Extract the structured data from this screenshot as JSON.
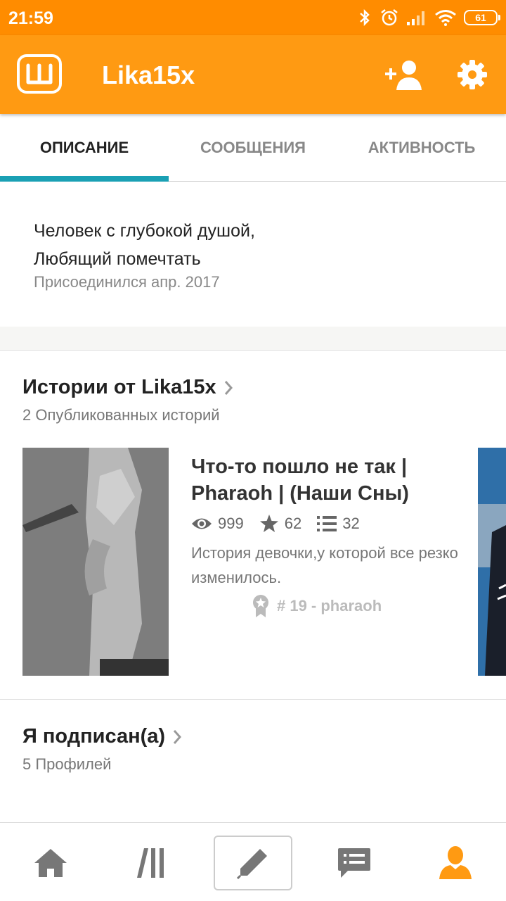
{
  "status_bar": {
    "time": "21:59",
    "battery": "61",
    "icons": [
      "bluetooth-icon",
      "alarm-icon",
      "signal-icon",
      "wifi-icon",
      "battery-icon"
    ]
  },
  "app_bar": {
    "title": "Lika15x",
    "logo_icon": "wattpad-logo",
    "actions": [
      "add-user-icon",
      "gear-icon"
    ]
  },
  "tabs": [
    {
      "label": "ОПИСАНИЕ",
      "active": true
    },
    {
      "label": "СООБЩЕНИЯ",
      "active": false
    },
    {
      "label": "АКТИВНОСТЬ",
      "active": false
    }
  ],
  "about": {
    "bio_line1": "Человек с глубокой душой,",
    "bio_line2": "Любящий помечтать",
    "joined": "Присоединился апр. 2017"
  },
  "stories": {
    "title": "Истории от Lika15x",
    "subtitle": "2 Опубликованных историй",
    "items": [
      {
        "title": "Что-то пошло не так | Pharaoh | (Наши Сны)",
        "reads": "999",
        "votes": "62",
        "parts": "32",
        "description": "История девочки,у которой все резко изменилось.",
        "rank": "# 19 - pharaoh"
      }
    ]
  },
  "following": {
    "title": "Я подписан(а)",
    "subtitle": "5 Профилей"
  },
  "bottom_nav": {
    "items": [
      "home-icon",
      "library-icon",
      "write-icon",
      "messages-icon",
      "profile-icon"
    ],
    "active": "profile-icon"
  },
  "colors": {
    "status_bar": "#ff8c00",
    "app_bar": "#ff9a12",
    "tab_indicator": "#1aa0b4",
    "active_nav": "#ff9a12"
  }
}
